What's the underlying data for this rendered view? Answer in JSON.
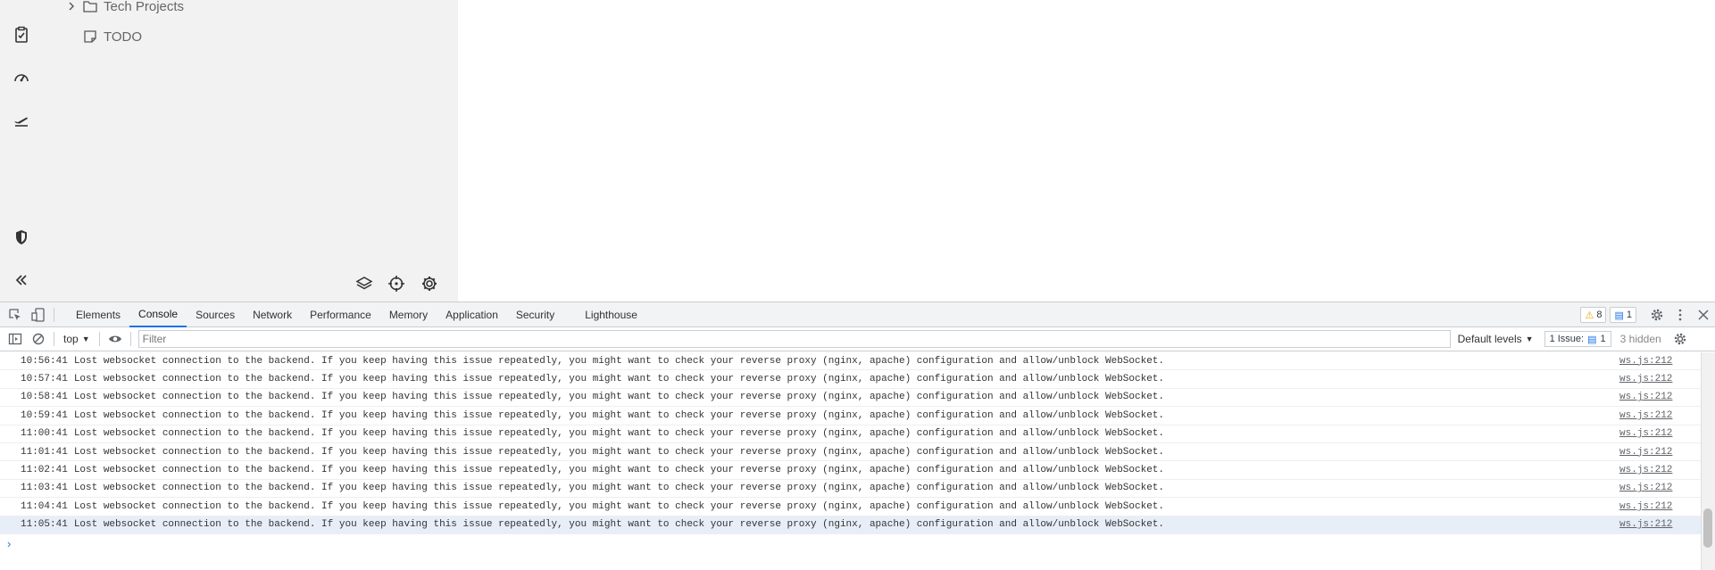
{
  "sidebar": {
    "tree": [
      {
        "label": "Tech Projects",
        "type": "folder",
        "expandable": true
      },
      {
        "label": "TODO",
        "type": "note"
      }
    ]
  },
  "devtools": {
    "tabs": [
      {
        "label": "Elements",
        "active": false
      },
      {
        "label": "Console",
        "active": true
      },
      {
        "label": "Sources",
        "active": false
      },
      {
        "label": "Network",
        "active": false
      },
      {
        "label": "Performance",
        "active": false
      },
      {
        "label": "Memory",
        "active": false
      },
      {
        "label": "Application",
        "active": false
      },
      {
        "label": "Security",
        "active": false
      },
      {
        "label": "Lighthouse",
        "active": false
      }
    ],
    "warnings_count": "8",
    "messages_count": "1",
    "toolbar": {
      "context": "top",
      "filter_placeholder": "Filter",
      "levels": "Default levels",
      "issues_label": "1 Issue:",
      "issues_count": "1",
      "hidden": "3 hidden"
    },
    "console": {
      "message": "Lost websocket connection to the backend. If you keep having this issue repeatedly, you might want to check your reverse proxy (nginx, apache) configuration and allow/unblock WebSocket.",
      "source": "ws.js:212",
      "timestamps": [
        "10:56:41",
        "10:57:41",
        "10:58:41",
        "10:59:41",
        "11:00:41",
        "11:01:41",
        "11:02:41",
        "11:03:41",
        "11:04:41",
        "11:05:41"
      ],
      "prompt_symbol": "›"
    }
  }
}
